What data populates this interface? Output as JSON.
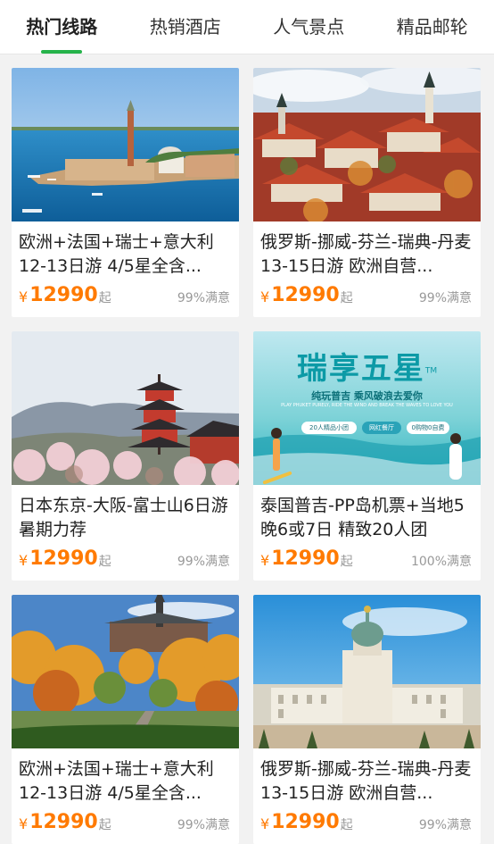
{
  "tabs": [
    {
      "label": "热门线路",
      "active": true
    },
    {
      "label": "热销酒店",
      "active": false
    },
    {
      "label": "人气景点",
      "active": false
    },
    {
      "label": "精品邮轮",
      "active": false
    }
  ],
  "accent_color": "#25b34a",
  "price_color": "#ff7a00",
  "cards": [
    {
      "title": "欧洲+法国+瑞士+意大利12-13日游 4/5星全含...",
      "currency": "¥",
      "price": "12990",
      "price_suffix": "起",
      "satisfaction": "99%满意",
      "image": "venice-island-photo"
    },
    {
      "title": "俄罗斯-挪威-芬兰-瑞典-丹麦13-15日游 欧洲自营...",
      "currency": "¥",
      "price": "12990",
      "price_suffix": "起",
      "satisfaction": "99%满意",
      "image": "tallinn-old-town-photo"
    },
    {
      "title": "日本东京-大阪-富士山6日游 暑期力荐",
      "currency": "¥",
      "price": "12990",
      "price_suffix": "起",
      "satisfaction": "99%满意",
      "image": "kyoto-pagoda-photo"
    },
    {
      "title": "泰国普吉-PP岛机票+当地5晚6或7日 精致20人团",
      "currency": "¥",
      "price": "12990",
      "price_suffix": "起",
      "satisfaction": "100%满意",
      "image": "phuket-promo-banner",
      "promo": {
        "headline": "瑞享五星",
        "tm": "TM",
        "subline": "纯玩普吉  乘风破浪去爱你",
        "english": "PLAY PHUKET PURELY, RIDE THE WIND AND BREAK THE WAVES TO LOVE YOU",
        "badges": [
          "20人精品小团",
          "网红餐厅",
          "0购物0自费"
        ]
      }
    },
    {
      "title": "欧洲+法国+瑞士+意大利12-13日游 4/5星全含...",
      "currency": "¥",
      "price": "12990",
      "price_suffix": "起",
      "satisfaction": "99%满意",
      "image": "autumn-castle-photo"
    },
    {
      "title": "俄罗斯-挪威-芬兰-瑞典-丹麦13-15日游 欧洲自营...",
      "currency": "¥",
      "price": "12990",
      "price_suffix": "起",
      "satisfaction": "99%满意",
      "image": "baroque-palace-photo"
    }
  ]
}
